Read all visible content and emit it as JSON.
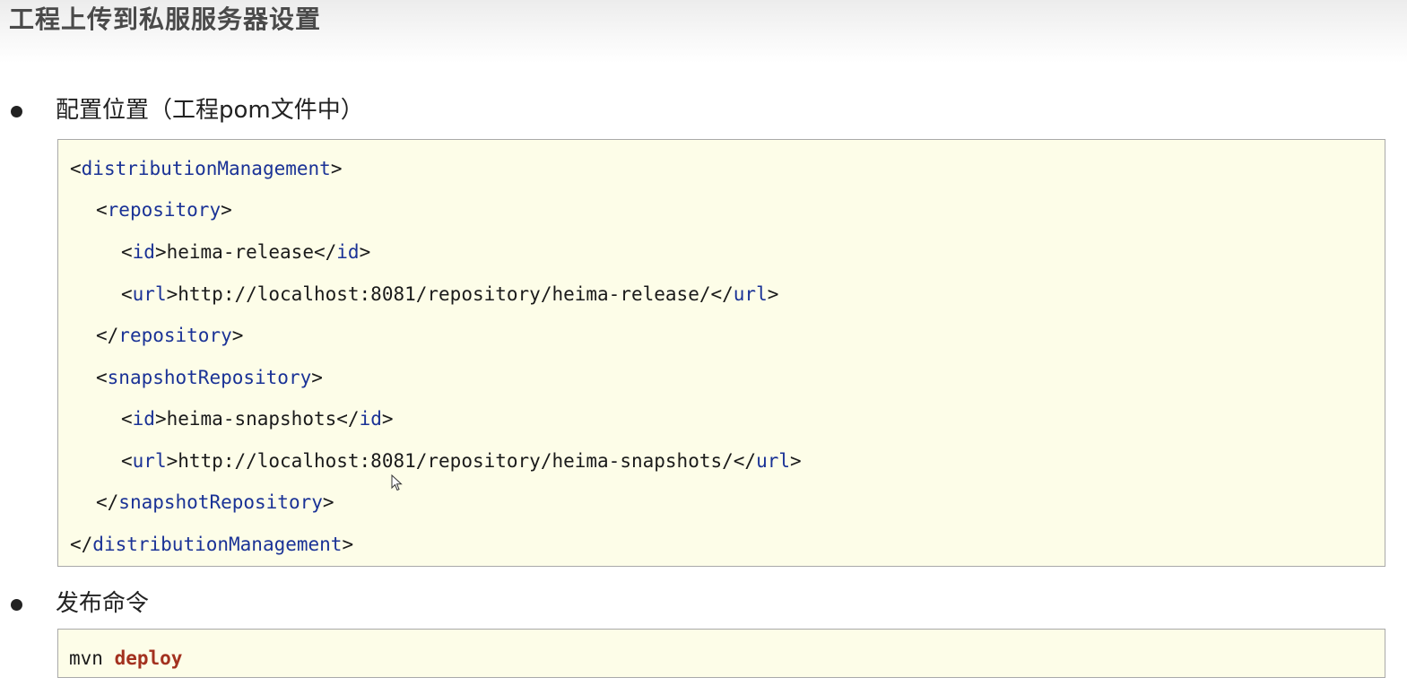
{
  "page": {
    "title": "工程上传到私服服务器设置"
  },
  "sections": [
    {
      "heading": "配置位置（工程pom文件中）",
      "code": {
        "l1_open": "<",
        "l1_tag": "distributionManagement",
        "l1_close": ">",
        "l2_open": "<",
        "l2_tag": "repository",
        "l2_close": ">",
        "l3_open": "<",
        "l3_tag": "id",
        "l3_close": ">",
        "l3_text": "heima-release",
        "l3_end_open": "</",
        "l3_end_tag": "id",
        "l3_end_close": ">",
        "l4_open": "<",
        "l4_tag": "url",
        "l4_close": ">",
        "l4_text": "http://localhost:8081/repository/heima-release/",
        "l4_end_open": "</",
        "l4_end_tag": "url",
        "l4_end_close": ">",
        "l5_open": "</",
        "l5_tag": "repository",
        "l5_close": ">",
        "l6_open": "<",
        "l6_tag": "snapshotRepository",
        "l6_close": ">",
        "l7_open": "<",
        "l7_tag": "id",
        "l7_close": ">",
        "l7_text": "heima-snapshots",
        "l7_end_open": "</",
        "l7_end_tag": "id",
        "l7_end_close": ">",
        "l8_open": "<",
        "l8_tag": "url",
        "l8_close": ">",
        "l8_text": "http://localhost:8081/repository/heima-snapshots/",
        "l8_end_open": "</",
        "l8_end_tag": "url",
        "l8_end_close": ">",
        "l9_open": "</",
        "l9_tag": "snapshotRepository",
        "l9_close": ">",
        "l10_open": "</",
        "l10_tag": "distributionManagement",
        "l10_close": ">"
      }
    },
    {
      "heading": "发布命令",
      "command": {
        "program": "mvn",
        "goal": "deploy"
      }
    }
  ],
  "icons": {
    "cursor": "mouse-pointer-icon"
  },
  "colors": {
    "code_background": "#fdfde8",
    "code_border": "#a9a9a9",
    "xml_tag": "#1a3296",
    "keyword": "#a3311f"
  }
}
